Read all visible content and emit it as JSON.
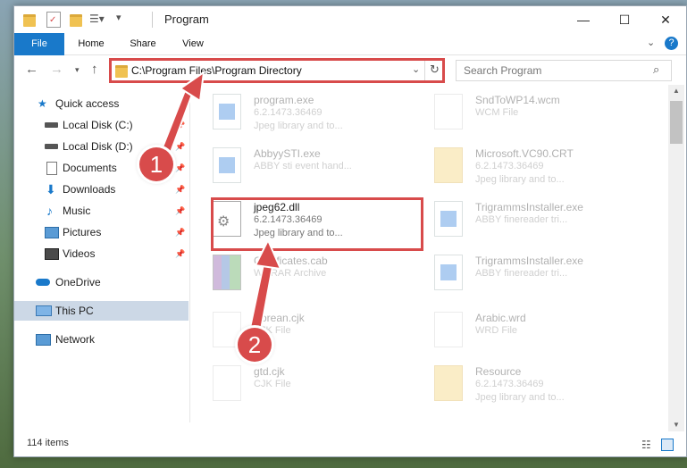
{
  "window": {
    "title": "Program",
    "controls": {
      "minimize": "—",
      "maximize": "☐",
      "close": "✕"
    }
  },
  "ribbon": {
    "tabs": [
      {
        "label": "File"
      },
      {
        "label": "Home"
      },
      {
        "label": "Share"
      },
      {
        "label": "View"
      }
    ]
  },
  "nav": {
    "address": "C:\\Program Files\\Program Directory",
    "search_placeholder": "Search Program"
  },
  "sidebar": {
    "items": [
      {
        "label": "Quick access",
        "icon": "star-icon"
      },
      {
        "label": "Local Disk (C:)",
        "icon": "drive-icon",
        "pinned": true
      },
      {
        "label": "Local Disk (D:)",
        "icon": "drive-icon",
        "pinned": true
      },
      {
        "label": "Documents",
        "icon": "documents-icon",
        "pinned": true
      },
      {
        "label": "Downloads",
        "icon": "downloads-icon",
        "pinned": true
      },
      {
        "label": "Music",
        "icon": "music-icon",
        "pinned": true
      },
      {
        "label": "Pictures",
        "icon": "pictures-icon",
        "pinned": true
      },
      {
        "label": "Videos",
        "icon": "videos-icon",
        "pinned": true
      },
      {
        "label": "OneDrive",
        "icon": "cloud-icon"
      },
      {
        "label": "This PC",
        "icon": "pc-icon",
        "selected": true
      },
      {
        "label": "Network",
        "icon": "network-icon"
      }
    ]
  },
  "files": {
    "left": [
      {
        "name": "program.exe",
        "line2": "6.2.1473.36469",
        "line3": "Jpeg library and to...",
        "type": "exe",
        "faded": true
      },
      {
        "name": "AbbyySTI.exe",
        "line2": "ABBY sti event hand...",
        "line3": "",
        "type": "exe",
        "faded": true
      },
      {
        "name": "jpeg62.dll",
        "line2": "6.2.1473.36469",
        "line3": "Jpeg library and to...",
        "type": "dll",
        "faded": false
      },
      {
        "name": "Certificates.cab",
        "line2": "WinRAR Archive",
        "line3": "",
        "type": "rar",
        "faded": true
      },
      {
        "name": "Korean.cjk",
        "line2": "CJK File",
        "line3": "",
        "type": "doc",
        "faded": true
      },
      {
        "name": "gtd.cjk",
        "line2": "CJK File",
        "line3": "",
        "type": "doc",
        "faded": true
      }
    ],
    "right": [
      {
        "name": "SndToWP14.wcm",
        "line2": "WCM File",
        "line3": "",
        "type": "doc",
        "faded": true
      },
      {
        "name": "Microsoft.VC90.CRT",
        "line2": "6.2.1473.36469",
        "line3": "Jpeg library and to...",
        "type": "folder",
        "faded": true
      },
      {
        "name": "TrigrammsInstaller.exe",
        "line2": "ABBY finereader tri...",
        "line3": "",
        "type": "exe",
        "faded": true
      },
      {
        "name": "TrigrammsInstaller.exe",
        "line2": "ABBY finereader tri...",
        "line3": "",
        "type": "exe",
        "faded": true
      },
      {
        "name": "Arabic.wrd",
        "line2": "WRD File",
        "line3": "",
        "type": "doc",
        "faded": true
      },
      {
        "name": "Resource",
        "line2": "6.2.1473.36469",
        "line3": "Jpeg library and to...",
        "type": "folder",
        "faded": true
      }
    ]
  },
  "status": {
    "item_count": "114 items"
  },
  "annotations": {
    "step1": "1",
    "step2": "2",
    "accent_color": "#d84b4b"
  }
}
